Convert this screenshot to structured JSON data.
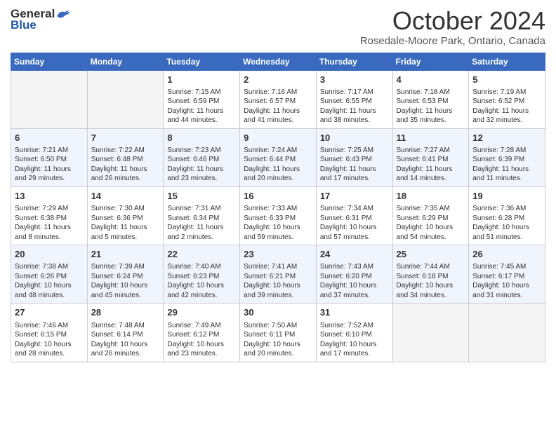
{
  "header": {
    "logo_general": "General",
    "logo_blue": "Blue",
    "month": "October 2024",
    "location": "Rosedale-Moore Park, Ontario, Canada"
  },
  "days_of_week": [
    "Sunday",
    "Monday",
    "Tuesday",
    "Wednesday",
    "Thursday",
    "Friday",
    "Saturday"
  ],
  "weeks": [
    [
      {
        "day": "",
        "sunrise": "",
        "sunset": "",
        "daylight": "",
        "empty": true
      },
      {
        "day": "",
        "sunrise": "",
        "sunset": "",
        "daylight": "",
        "empty": true
      },
      {
        "day": "1",
        "sunrise": "Sunrise: 7:15 AM",
        "sunset": "Sunset: 6:59 PM",
        "daylight": "Daylight: 11 hours and 44 minutes.",
        "empty": false
      },
      {
        "day": "2",
        "sunrise": "Sunrise: 7:16 AM",
        "sunset": "Sunset: 6:57 PM",
        "daylight": "Daylight: 11 hours and 41 minutes.",
        "empty": false
      },
      {
        "day": "3",
        "sunrise": "Sunrise: 7:17 AM",
        "sunset": "Sunset: 6:55 PM",
        "daylight": "Daylight: 11 hours and 38 minutes.",
        "empty": false
      },
      {
        "day": "4",
        "sunrise": "Sunrise: 7:18 AM",
        "sunset": "Sunset: 6:53 PM",
        "daylight": "Daylight: 11 hours and 35 minutes.",
        "empty": false
      },
      {
        "day": "5",
        "sunrise": "Sunrise: 7:19 AM",
        "sunset": "Sunset: 6:52 PM",
        "daylight": "Daylight: 11 hours and 32 minutes.",
        "empty": false
      }
    ],
    [
      {
        "day": "6",
        "sunrise": "Sunrise: 7:21 AM",
        "sunset": "Sunset: 6:50 PM",
        "daylight": "Daylight: 11 hours and 29 minutes.",
        "empty": false
      },
      {
        "day": "7",
        "sunrise": "Sunrise: 7:22 AM",
        "sunset": "Sunset: 6:48 PM",
        "daylight": "Daylight: 11 hours and 26 minutes.",
        "empty": false
      },
      {
        "day": "8",
        "sunrise": "Sunrise: 7:23 AM",
        "sunset": "Sunset: 6:46 PM",
        "daylight": "Daylight: 11 hours and 23 minutes.",
        "empty": false
      },
      {
        "day": "9",
        "sunrise": "Sunrise: 7:24 AM",
        "sunset": "Sunset: 6:44 PM",
        "daylight": "Daylight: 11 hours and 20 minutes.",
        "empty": false
      },
      {
        "day": "10",
        "sunrise": "Sunrise: 7:25 AM",
        "sunset": "Sunset: 6:43 PM",
        "daylight": "Daylight: 11 hours and 17 minutes.",
        "empty": false
      },
      {
        "day": "11",
        "sunrise": "Sunrise: 7:27 AM",
        "sunset": "Sunset: 6:41 PM",
        "daylight": "Daylight: 11 hours and 14 minutes.",
        "empty": false
      },
      {
        "day": "12",
        "sunrise": "Sunrise: 7:28 AM",
        "sunset": "Sunset: 6:39 PM",
        "daylight": "Daylight: 11 hours and 11 minutes.",
        "empty": false
      }
    ],
    [
      {
        "day": "13",
        "sunrise": "Sunrise: 7:29 AM",
        "sunset": "Sunset: 6:38 PM",
        "daylight": "Daylight: 11 hours and 8 minutes.",
        "empty": false
      },
      {
        "day": "14",
        "sunrise": "Sunrise: 7:30 AM",
        "sunset": "Sunset: 6:36 PM",
        "daylight": "Daylight: 11 hours and 5 minutes.",
        "empty": false
      },
      {
        "day": "15",
        "sunrise": "Sunrise: 7:31 AM",
        "sunset": "Sunset: 6:34 PM",
        "daylight": "Daylight: 11 hours and 2 minutes.",
        "empty": false
      },
      {
        "day": "16",
        "sunrise": "Sunrise: 7:33 AM",
        "sunset": "Sunset: 6:33 PM",
        "daylight": "Daylight: 10 hours and 59 minutes.",
        "empty": false
      },
      {
        "day": "17",
        "sunrise": "Sunrise: 7:34 AM",
        "sunset": "Sunset: 6:31 PM",
        "daylight": "Daylight: 10 hours and 57 minutes.",
        "empty": false
      },
      {
        "day": "18",
        "sunrise": "Sunrise: 7:35 AM",
        "sunset": "Sunset: 6:29 PM",
        "daylight": "Daylight: 10 hours and 54 minutes.",
        "empty": false
      },
      {
        "day": "19",
        "sunrise": "Sunrise: 7:36 AM",
        "sunset": "Sunset: 6:28 PM",
        "daylight": "Daylight: 10 hours and 51 minutes.",
        "empty": false
      }
    ],
    [
      {
        "day": "20",
        "sunrise": "Sunrise: 7:38 AM",
        "sunset": "Sunset: 6:26 PM",
        "daylight": "Daylight: 10 hours and 48 minutes.",
        "empty": false
      },
      {
        "day": "21",
        "sunrise": "Sunrise: 7:39 AM",
        "sunset": "Sunset: 6:24 PM",
        "daylight": "Daylight: 10 hours and 45 minutes.",
        "empty": false
      },
      {
        "day": "22",
        "sunrise": "Sunrise: 7:40 AM",
        "sunset": "Sunset: 6:23 PM",
        "daylight": "Daylight: 10 hours and 42 minutes.",
        "empty": false
      },
      {
        "day": "23",
        "sunrise": "Sunrise: 7:41 AM",
        "sunset": "Sunset: 6:21 PM",
        "daylight": "Daylight: 10 hours and 39 minutes.",
        "empty": false
      },
      {
        "day": "24",
        "sunrise": "Sunrise: 7:43 AM",
        "sunset": "Sunset: 6:20 PM",
        "daylight": "Daylight: 10 hours and 37 minutes.",
        "empty": false
      },
      {
        "day": "25",
        "sunrise": "Sunrise: 7:44 AM",
        "sunset": "Sunset: 6:18 PM",
        "daylight": "Daylight: 10 hours and 34 minutes.",
        "empty": false
      },
      {
        "day": "26",
        "sunrise": "Sunrise: 7:45 AM",
        "sunset": "Sunset: 6:17 PM",
        "daylight": "Daylight: 10 hours and 31 minutes.",
        "empty": false
      }
    ],
    [
      {
        "day": "27",
        "sunrise": "Sunrise: 7:46 AM",
        "sunset": "Sunset: 6:15 PM",
        "daylight": "Daylight: 10 hours and 28 minutes.",
        "empty": false
      },
      {
        "day": "28",
        "sunrise": "Sunrise: 7:48 AM",
        "sunset": "Sunset: 6:14 PM",
        "daylight": "Daylight: 10 hours and 26 minutes.",
        "empty": false
      },
      {
        "day": "29",
        "sunrise": "Sunrise: 7:49 AM",
        "sunset": "Sunset: 6:12 PM",
        "daylight": "Daylight: 10 hours and 23 minutes.",
        "empty": false
      },
      {
        "day": "30",
        "sunrise": "Sunrise: 7:50 AM",
        "sunset": "Sunset: 6:11 PM",
        "daylight": "Daylight: 10 hours and 20 minutes.",
        "empty": false
      },
      {
        "day": "31",
        "sunrise": "Sunrise: 7:52 AM",
        "sunset": "Sunset: 6:10 PM",
        "daylight": "Daylight: 10 hours and 17 minutes.",
        "empty": false
      },
      {
        "day": "",
        "sunrise": "",
        "sunset": "",
        "daylight": "",
        "empty": true
      },
      {
        "day": "",
        "sunrise": "",
        "sunset": "",
        "daylight": "",
        "empty": true
      }
    ]
  ]
}
